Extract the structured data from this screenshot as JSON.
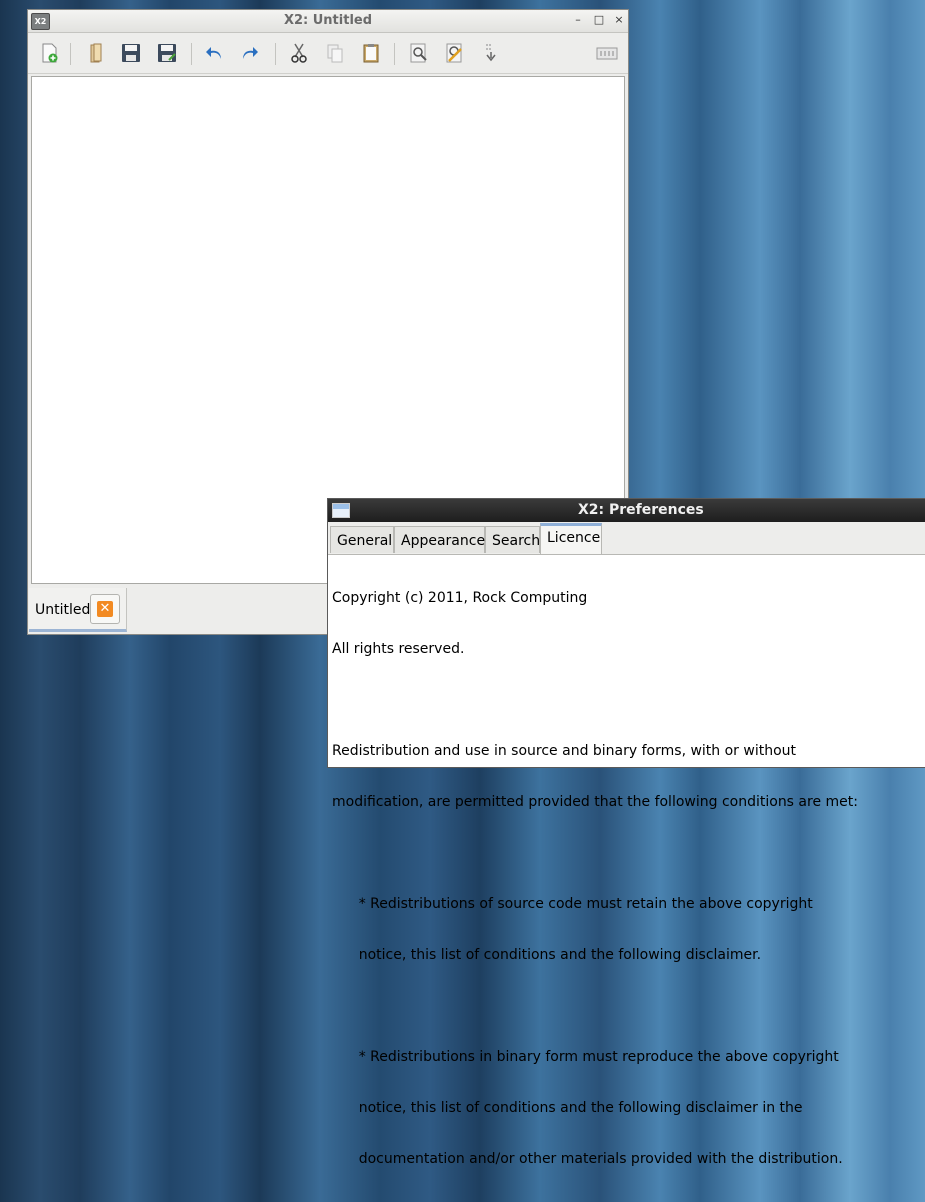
{
  "main_window": {
    "title": "X2: Untitled",
    "app_icon_text": "X2",
    "controls": {
      "minimize": "–",
      "maximize": "□",
      "close": "×"
    },
    "toolbar": [
      {
        "name": "new-file-icon"
      },
      {
        "name": "open-file-icon"
      },
      {
        "name": "save-icon"
      },
      {
        "name": "save-as-icon"
      },
      {
        "name": "undo-icon"
      },
      {
        "name": "redo-icon"
      },
      {
        "name": "cut-icon"
      },
      {
        "name": "copy-icon"
      },
      {
        "name": "paste-icon"
      },
      {
        "name": "find-icon"
      },
      {
        "name": "find-replace-icon"
      },
      {
        "name": "goto-line-icon"
      },
      {
        "name": "preferences-icon"
      }
    ],
    "document_tab": {
      "label": "Untitled"
    }
  },
  "preferences_window": {
    "title": "X2: Preferences",
    "tabs": [
      "General",
      "Appearance",
      "Search",
      "Licence"
    ],
    "active_tab": "Licence",
    "licence_lines": [
      "Copyright (c) 2011, Rock Computing",
      "All rights reserved.",
      "",
      "Redistribution and use in source and binary forms, with or without",
      "modification, are permitted provided that the following conditions are met:",
      "",
      "      * Redistributions of source code must retain the above copyright",
      "      notice, this list of conditions and the following disclaimer.",
      "",
      "      * Redistributions in binary form must reproduce the above copyright",
      "      notice, this list of conditions and the following disclaimer in the",
      "      documentation and/or other materials provided with the distribution."
    ]
  },
  "colors": {
    "desktop": "#2a5279",
    "accent": "#8fb0d8",
    "close_button": "#f28a22"
  }
}
